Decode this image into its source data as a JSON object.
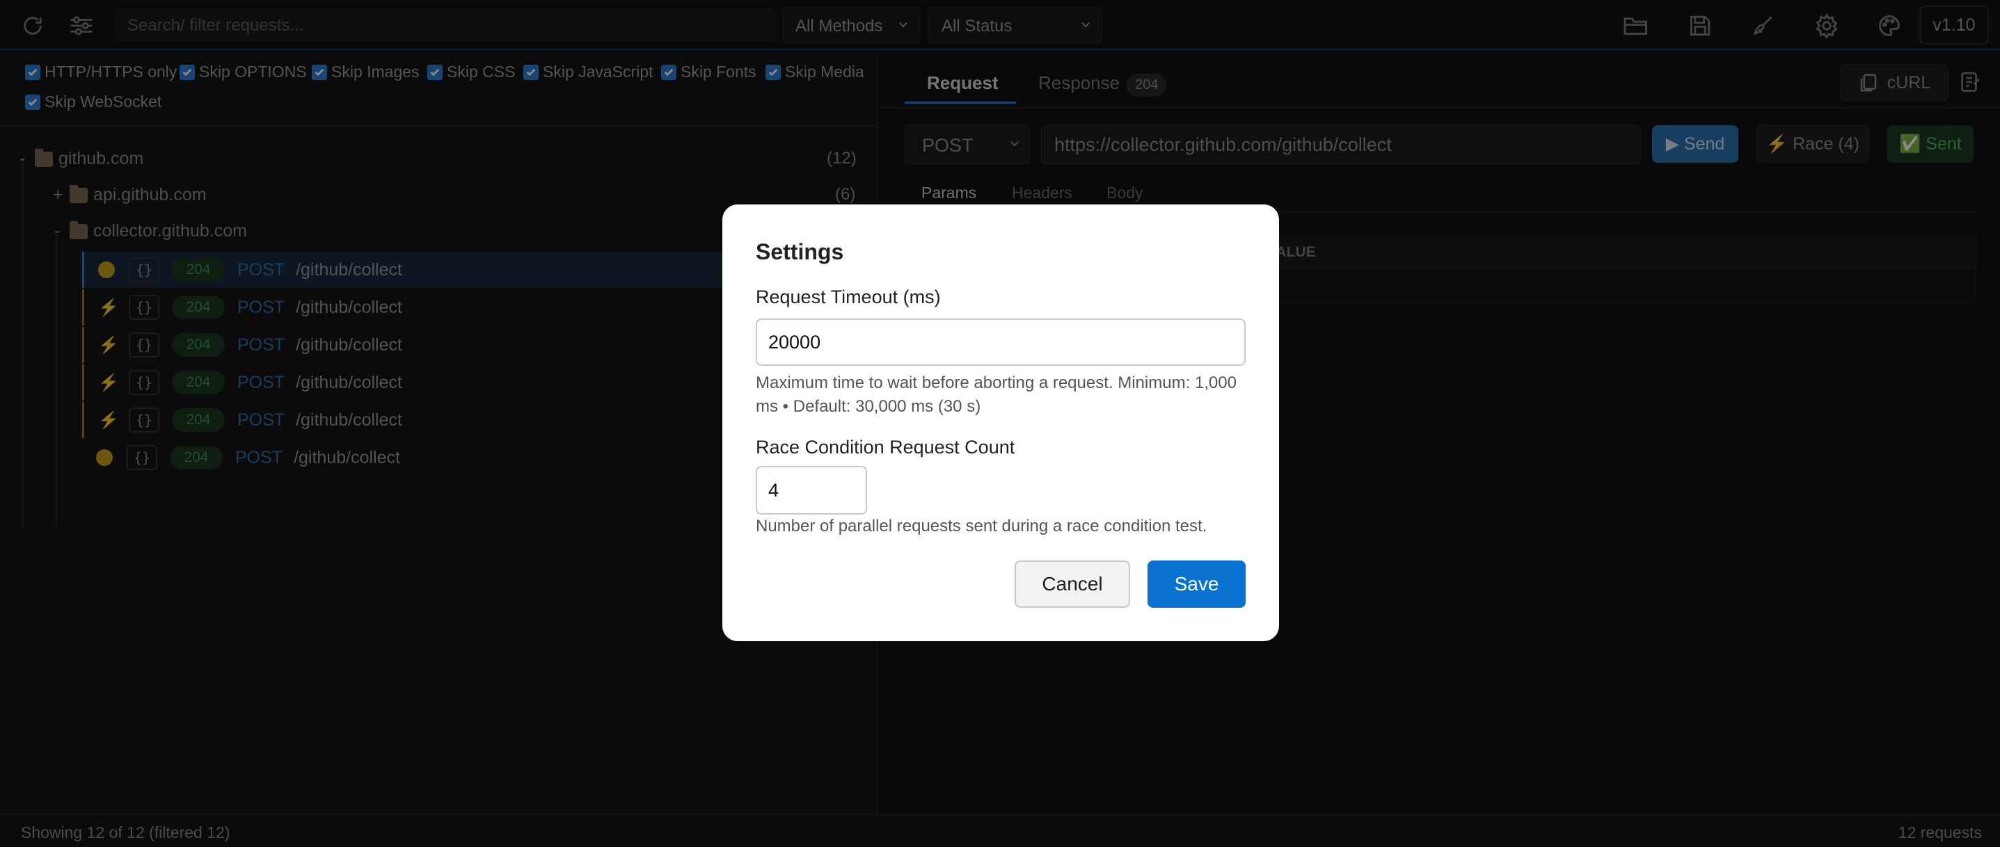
{
  "toolbar": {
    "search_placeholder": "Search/ filter requests...",
    "methods_select": "All Methods",
    "status_select": "All Status",
    "version": "v1.10"
  },
  "filters": [
    {
      "label": "HTTP/HTTPS only",
      "checked": true
    },
    {
      "label": "Skip OPTIONS",
      "checked": true
    },
    {
      "label": "Skip Images",
      "checked": true
    },
    {
      "label": "Skip CSS",
      "checked": true
    },
    {
      "label": "Skip JavaScript",
      "checked": true
    },
    {
      "label": "Skip Fonts",
      "checked": true
    },
    {
      "label": "Skip Media",
      "checked": true
    },
    {
      "label": "Skip WebSocket",
      "checked": true
    }
  ],
  "tree": {
    "root": {
      "toggle": "-",
      "name": "github.com",
      "count": "(12)"
    },
    "api": {
      "toggle": "+",
      "name": "api.github.com",
      "count": "(6)"
    },
    "collector": {
      "toggle": "-",
      "name": "collector.github.com"
    },
    "requests": [
      {
        "marker": "dot",
        "braces": "{}",
        "status": "204",
        "method": "POST",
        "path": "/github/collect",
        "selected": true
      },
      {
        "marker": "bolt",
        "braces": "{}",
        "status": "204",
        "method": "POST",
        "path": "/github/collect"
      },
      {
        "marker": "bolt",
        "braces": "{}",
        "status": "204",
        "method": "POST",
        "path": "/github/collect"
      },
      {
        "marker": "bolt",
        "braces": "{}",
        "status": "204",
        "method": "POST",
        "path": "/github/collect"
      },
      {
        "marker": "bolt",
        "braces": "{}",
        "status": "204",
        "method": "POST",
        "path": "/github/collect"
      },
      {
        "marker": "dot",
        "braces": "{}",
        "status": "204",
        "method": "POST",
        "path": "/github/collect"
      }
    ]
  },
  "status_bar": {
    "left": "Showing 12 of 12 (filtered 12)",
    "right": "12 requests"
  },
  "detail": {
    "tab_request": "Request",
    "tab_response": "Response",
    "response_badge": "204",
    "curl_label": "cURL",
    "method": "POST",
    "url": "https://collector.github.com/github/collect",
    "send_label": "▶ Send",
    "race_label": "⚡ Race (4)",
    "sent_label": "✅ Sent",
    "subtabs": [
      "Params",
      "Headers",
      "Body"
    ],
    "value_header": "VALUE"
  },
  "settings": {
    "title": "Settings",
    "timeout_label": "Request Timeout (ms)",
    "timeout_value": "20000",
    "timeout_help": "Maximum time to wait before aborting a request. Minimum: 1,000 ms • Default: 30,000 ms (30 s)",
    "race_label": "Race Condition Request Count",
    "race_value": "4",
    "race_help": "Number of parallel requests sent during a race condition test.",
    "cancel": "Cancel",
    "save": "Save"
  },
  "colors": {
    "accent": "#0a72d1",
    "status_green": "#3d8f52",
    "marker_yellow": "#c7a022"
  }
}
